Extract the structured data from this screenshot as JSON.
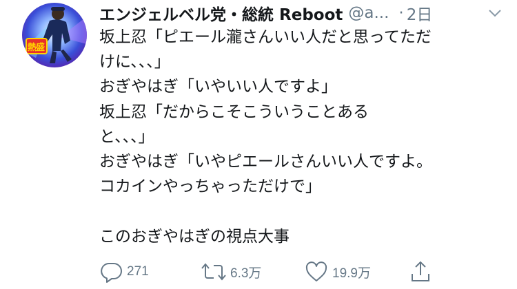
{
  "tweet": {
    "display_name": "エンジェルベル党・総統 Reboot",
    "handle": "@a...",
    "separator": "·",
    "time": "2日",
    "avatar_text": "熱盛",
    "body_lines": [
      "坂上忍「ピエール瀧さんいい人だと思ってただ",
      "けに、、、」",
      "おぎやはぎ「いやいい人ですよ」",
      "坂上忍「だからこそこういうことある",
      "と、、、」",
      "おぎやはぎ「いやピエールさんいい人ですよ。",
      "コカインやっちゃっただけで」",
      "",
      "このおぎやはぎの視点大事"
    ],
    "actions": {
      "reply_count": "271",
      "retweet_count": "6.3万",
      "like_count": "19.9万"
    }
  },
  "colors": {
    "text": "#14171a",
    "secondary": "#657786",
    "avatar_bg": "#3a4fd8",
    "avatar_badge": "#e8302a"
  }
}
